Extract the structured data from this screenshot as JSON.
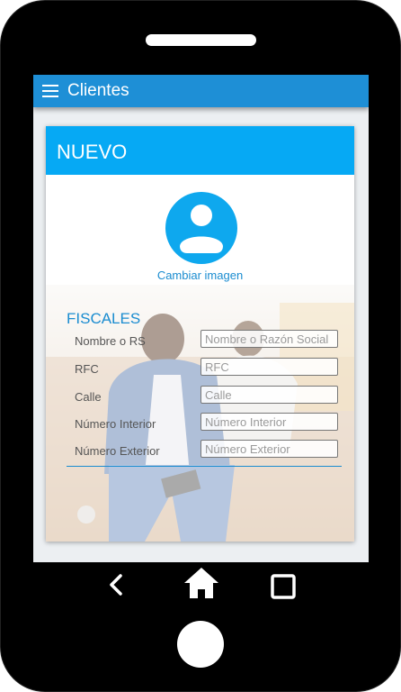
{
  "app": {
    "title": "Clientes"
  },
  "card": {
    "title": "NUEVO",
    "change_image_label": "Cambiar imagen"
  },
  "fiscales": {
    "section_title": "FISCALES",
    "fields": [
      {
        "label": "Nombre o RS",
        "placeholder": "Nombre o Razón Social",
        "value": ""
      },
      {
        "label": "RFC",
        "placeholder": "RFC",
        "value": ""
      },
      {
        "label": "Calle",
        "placeholder": "Calle",
        "value": ""
      },
      {
        "label": "Número Interior",
        "placeholder": "Número Interior",
        "value": ""
      },
      {
        "label": "Número Exterior",
        "placeholder": "Número Exterior",
        "value": ""
      }
    ]
  },
  "icons": {
    "menu": "menu-icon",
    "avatar": "account-circle-icon",
    "back": "back-icon",
    "home": "home-icon",
    "recents": "recents-icon"
  },
  "colors": {
    "app_bar": "#1e8fd6",
    "card_header": "#06a9f4",
    "accent": "#1a8cd0",
    "avatar": "#0ea8ee"
  }
}
